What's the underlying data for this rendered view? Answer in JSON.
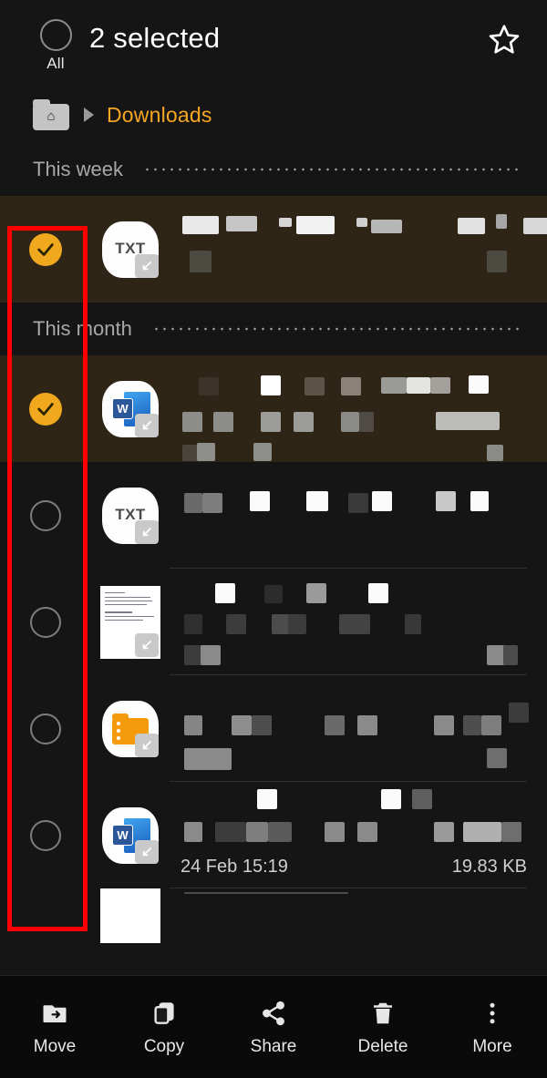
{
  "header": {
    "all_label": "All",
    "title": "2 selected",
    "star_icon": "star-outline-icon",
    "all_checkbox_icon": "circle-unchecked-icon"
  },
  "breadcrumb": {
    "home_icon": "home-folder-icon",
    "separator_icon": "triangle-right-icon",
    "current": "Downloads"
  },
  "accent_colors": {
    "selection_orange": "#f0a81e",
    "breadcrumb_orange": "#f5a623",
    "annotation_red": "#ff0000",
    "selected_row_background": "#2f2517",
    "page_background": "#151515",
    "toolbar_background": "#0a0a0a"
  },
  "sections": [
    {
      "label": "This week",
      "separator": "dotted-line",
      "items": [
        {
          "selected": true,
          "checkbox_icon": "circle-checked-icon",
          "file_icon": "txt-file-icon",
          "icon_label": "TXT",
          "name": "",
          "date": "",
          "size": ""
        }
      ]
    },
    {
      "label": "This month",
      "separator": "dotted-line",
      "items": [
        {
          "selected": true,
          "checkbox_icon": "circle-checked-icon",
          "file_icon": "word-document-icon",
          "icon_label": "W",
          "name": "",
          "date": "",
          "size": ""
        },
        {
          "selected": false,
          "checkbox_icon": "circle-unchecked-icon",
          "file_icon": "txt-file-icon",
          "icon_label": "TXT",
          "name": "",
          "date": "",
          "size": ""
        },
        {
          "selected": false,
          "checkbox_icon": "circle-unchecked-icon",
          "file_icon": "document-thumbnail-icon",
          "icon_label": "",
          "name": "",
          "date": "",
          "size": ""
        },
        {
          "selected": false,
          "checkbox_icon": "circle-unchecked-icon",
          "file_icon": "zip-folder-icon",
          "icon_label": "",
          "name": "",
          "date": "",
          "size": ""
        },
        {
          "selected": false,
          "checkbox_icon": "circle-unchecked-icon",
          "file_icon": "word-document-icon",
          "icon_label": "W",
          "name": "",
          "date": "24 Feb 15:19",
          "size": "19.83 KB"
        }
      ]
    }
  ],
  "toolbar": {
    "items": [
      {
        "label": "Move",
        "icon": "move-to-folder-icon"
      },
      {
        "label": "Copy",
        "icon": "copy-icon"
      },
      {
        "label": "Share",
        "icon": "share-icon"
      },
      {
        "label": "Delete",
        "icon": "trash-icon"
      },
      {
        "label": "More",
        "icon": "more-vertical-icon"
      }
    ]
  },
  "annotation": {
    "type": "red-rectangle-highlight",
    "target": "checkbox-column"
  }
}
